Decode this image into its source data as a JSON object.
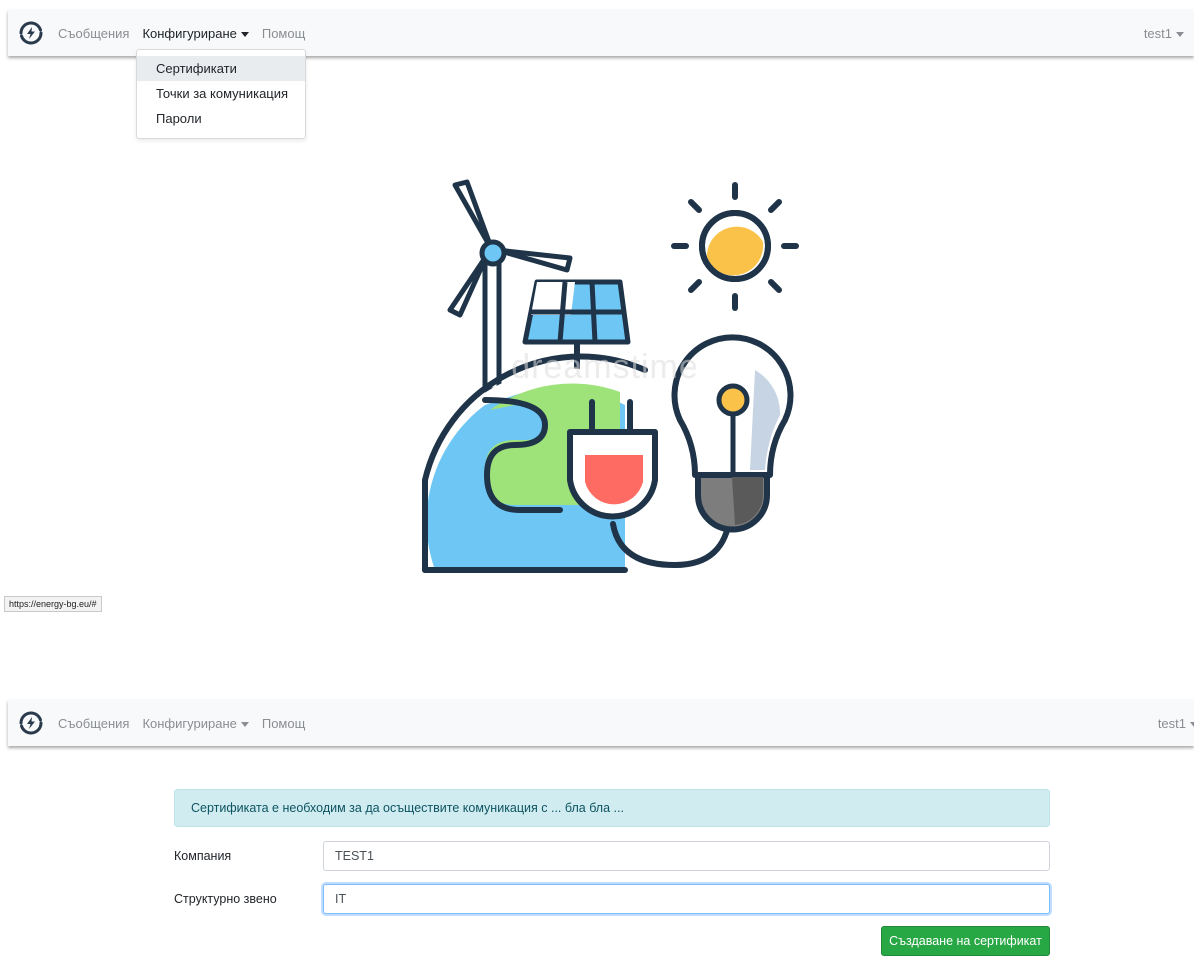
{
  "nav": {
    "items": [
      "Съобщения",
      "Конфигуриране",
      "Помощ"
    ],
    "user": "test1"
  },
  "dropdown": {
    "items": [
      "Сертификати",
      "Точки за комуникация",
      "Пароли"
    ]
  },
  "illustration": {
    "watermark": "dreamstime"
  },
  "status_bar": {
    "url": "https://energy-bg.eu/#"
  },
  "form": {
    "alert": "Сертификата е необходим за да осъществите комуникация с ... бла бла ...",
    "company_label": "Компания",
    "company_value": "TEST1",
    "unit_label": "Структурно звено",
    "unit_value": "IT",
    "submit_label": "Създаване на сертификат"
  },
  "colors": {
    "primary_brand": "#2a3a4d",
    "info_bg": "#d1ecf1",
    "success": "#28a745"
  }
}
